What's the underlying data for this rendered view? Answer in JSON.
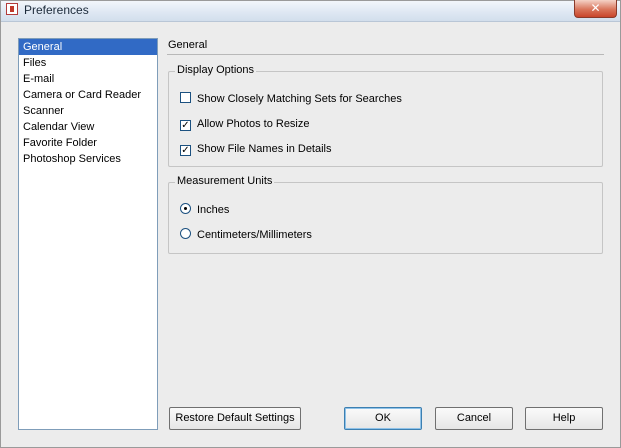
{
  "window": {
    "title": "Preferences",
    "close_glyph": "✕"
  },
  "sidebar": {
    "items": [
      {
        "label": "General"
      },
      {
        "label": "Files"
      },
      {
        "label": "E-mail"
      },
      {
        "label": "Camera or Card Reader"
      },
      {
        "label": "Scanner"
      },
      {
        "label": "Calendar View"
      },
      {
        "label": "Favorite Folder"
      },
      {
        "label": "Photoshop Services"
      }
    ],
    "selected": "General"
  },
  "panel": {
    "title": "General",
    "display_options": {
      "legend": "Display Options",
      "items": [
        {
          "label": "Show Closely Matching Sets for Searches",
          "checked": false,
          "mark": ""
        },
        {
          "label": "Allow Photos to Resize",
          "checked": true,
          "mark": "✓"
        },
        {
          "label": "Show File Names in Details",
          "checked": true,
          "mark": "✓"
        }
      ]
    },
    "measurement_units": {
      "legend": "Measurement Units",
      "options": [
        {
          "label": "Inches",
          "selected": true
        },
        {
          "label": "Centimeters/Millimeters",
          "selected": false
        }
      ]
    }
  },
  "buttons": {
    "restore": "Restore Default Settings",
    "ok": "OK",
    "cancel": "Cancel",
    "help": "Help"
  },
  "colors": {
    "selection": "#316ac5",
    "close": "#c9452b"
  }
}
